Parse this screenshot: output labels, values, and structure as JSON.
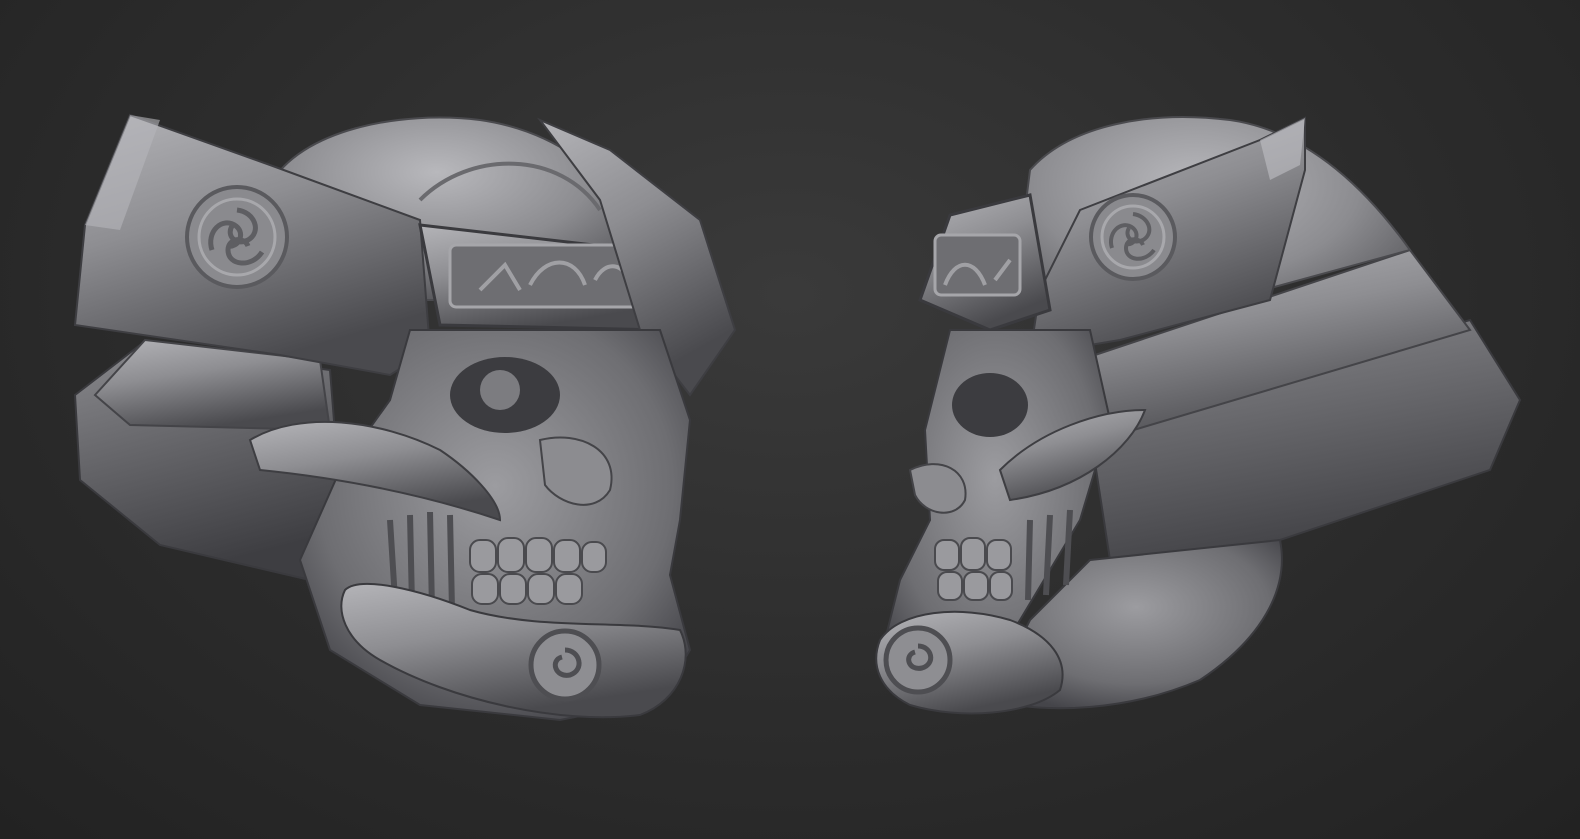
{
  "viewport": {
    "background_color": "#2c2c2c",
    "material_color": "#8e8e92",
    "material_shadow": "#3e3e42",
    "material_highlight": "#c4c4c8"
  },
  "models": [
    {
      "name": "samurai-skull-helmet",
      "facing": "right"
    },
    {
      "name": "samurai-skull-helmet",
      "facing": "left"
    }
  ]
}
